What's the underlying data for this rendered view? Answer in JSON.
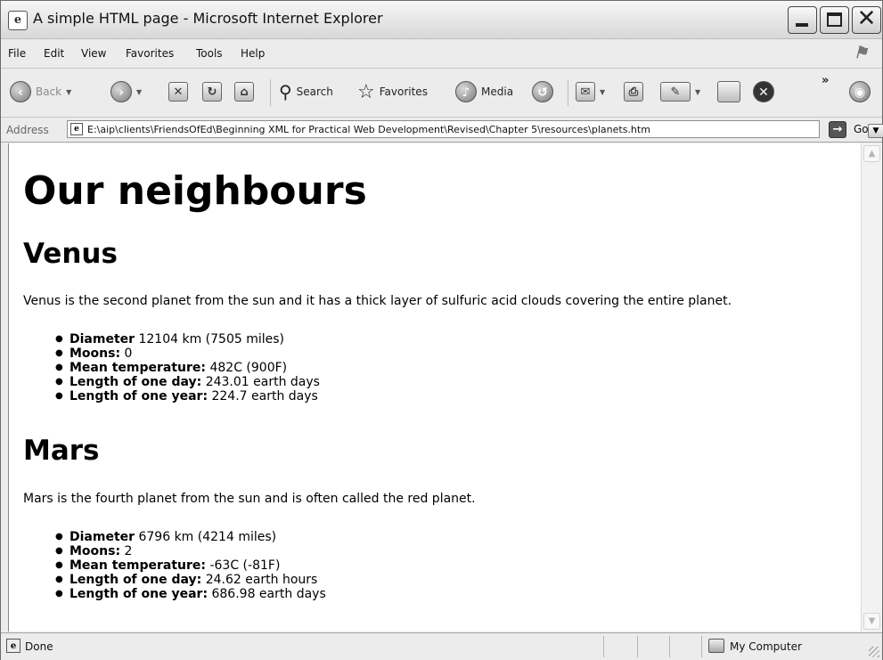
{
  "window": {
    "title": "A simple HTML page - Microsoft Internet Explorer",
    "app_icon": "e"
  },
  "menu": {
    "items": [
      "File",
      "Edit",
      "View",
      "Favorites",
      "Tools",
      "Help"
    ]
  },
  "toolbar": {
    "back_label": "Back",
    "search_label": "Search",
    "favorites_label": "Favorites",
    "media_label": "Media",
    "overflow": "»"
  },
  "address": {
    "label": "Address",
    "url": "E:\\aip\\clients\\FriendsOfEd\\Beginning XML for Practical Web Development\\Revised\\Chapter 5\\resources\\planets.htm",
    "go_label": "Go"
  },
  "page": {
    "heading": "Our neighbours",
    "planets": [
      {
        "name": "Venus",
        "description": "Venus is the second planet from the sun and it has a thick layer of sulfuric acid clouds covering the entire planet.",
        "facts": [
          {
            "label": "Diameter",
            "value": " 12104 km (7505 miles)"
          },
          {
            "label": "Moons:",
            "value": " 0"
          },
          {
            "label": "Mean temperature:",
            "value": " 482C (900F)"
          },
          {
            "label": "Length of one day:",
            "value": " 243.01 earth days"
          },
          {
            "label": "Length of one year:",
            "value": " 224.7 earth days"
          }
        ]
      },
      {
        "name": "Mars",
        "description": "Mars is the fourth planet from the sun and is often called the red planet.",
        "facts": [
          {
            "label": "Diameter",
            "value": " 6796 km (4214 miles)"
          },
          {
            "label": "Moons:",
            "value": " 2"
          },
          {
            "label": "Mean temperature:",
            "value": " -63C (-81F)"
          },
          {
            "label": "Length of one day:",
            "value": " 24.62 earth hours"
          },
          {
            "label": "Length of one year:",
            "value": " 686.98 earth days"
          }
        ]
      }
    ]
  },
  "status": {
    "text": "Done",
    "zone": "My Computer"
  }
}
